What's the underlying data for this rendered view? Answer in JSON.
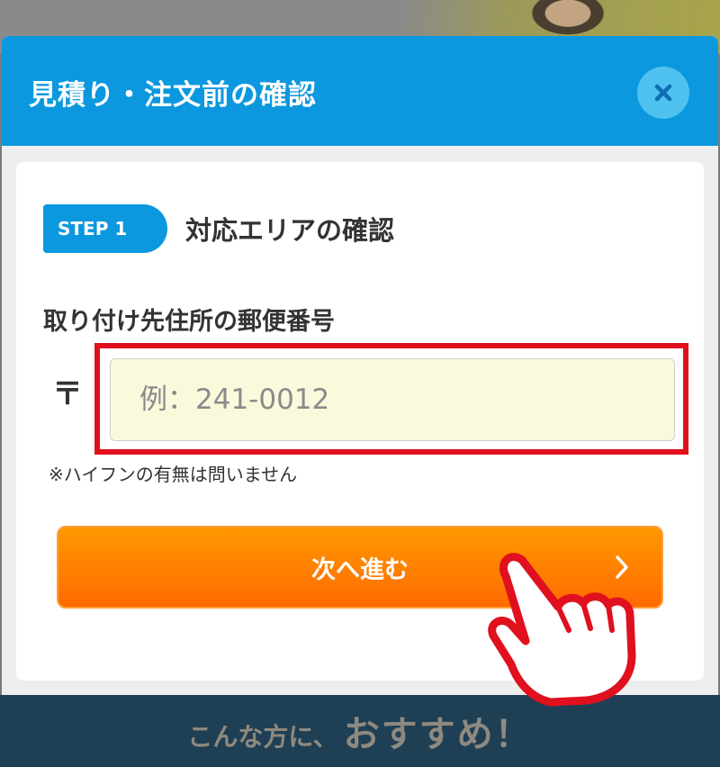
{
  "background": {
    "banner_small": "こんな方に、",
    "banner_big": "おすすめ！"
  },
  "modal": {
    "title": "見積り・注文前の確認",
    "close_icon": "close-icon",
    "step_badge": "STEP 1",
    "step_title": "対応エリアの確認",
    "zip_label": "取り付け先住所の郵便番号",
    "postal_mark": "〒",
    "zip_input": {
      "value": "",
      "placeholder": "例：241-0012"
    },
    "note": "※ハイフンの有無は問いません",
    "next_button_label": "次へ進む",
    "next_icon": "chevron-right-icon"
  },
  "colors": {
    "header_blue": "#0b98de",
    "button_orange": "#ff7f00",
    "highlight_red": "#e0101e",
    "input_bg": "#fbf9dc"
  }
}
